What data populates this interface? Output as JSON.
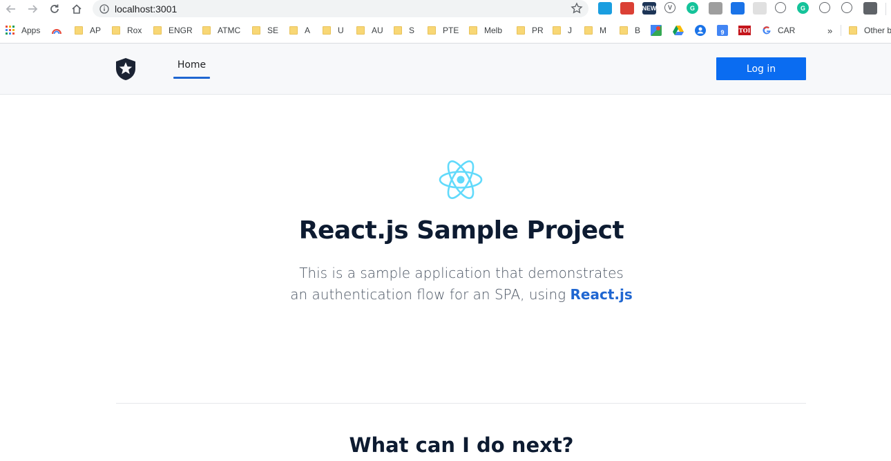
{
  "browser": {
    "url": "localhost:3001",
    "bookmarks": {
      "apps_label": "Apps",
      "items": [
        "AP",
        "Rox",
        "ENGR",
        "ATMC",
        "SE",
        "A",
        "U",
        "AU",
        "S",
        "PTE",
        "Melb",
        "PR",
        "J",
        "M",
        "B"
      ],
      "car_label": "CAR",
      "other_label": "Other b",
      "overflow_label": "»"
    },
    "extensions": [
      {
        "name": "tab-ext-icon",
        "color": "#1a9ee0",
        "text": ""
      },
      {
        "name": "todoist-icon",
        "color": "#db4035",
        "text": ""
      },
      {
        "name": "news-icon",
        "color": "#1d3557",
        "text": "NEW"
      },
      {
        "name": "vector-icon",
        "color": "#ffffff",
        "text": "V"
      },
      {
        "name": "grammarly-icon",
        "color": "#15c39a",
        "text": "G"
      },
      {
        "name": "avatar-ext-icon",
        "color": "#9e9e9e",
        "text": ""
      },
      {
        "name": "shield-ext-icon",
        "color": "#1a73e8",
        "text": ""
      },
      {
        "name": "speed-ext-icon",
        "color": "#e0e0e0",
        "text": ""
      },
      {
        "name": "history-ext-icon",
        "color": "#ffffff",
        "text": ""
      },
      {
        "name": "grammarly-alt-icon",
        "color": "#15c39a",
        "text": "G"
      },
      {
        "name": "code-ext-icon",
        "color": "#ffffff",
        "text": ""
      },
      {
        "name": "refresh-ext-icon",
        "color": "#ffffff",
        "text": ""
      },
      {
        "name": "pin-ext-icon",
        "color": "#5f6368",
        "text": ""
      }
    ],
    "bookmark_other_icons": {
      "toi_text": "TOI",
      "calendar_text": "9"
    }
  },
  "nav": {
    "home_label": "Home",
    "login_label": "Log in"
  },
  "hero": {
    "title": "React.js Sample Project",
    "text": "This is a sample application that demonstrates an authentication flow for an SPA, using ",
    "link": "React.js"
  },
  "next": {
    "title": "What can I do next?"
  },
  "colors": {
    "accent": "#0a6cf1",
    "link": "#1f66d1",
    "react": "#61dafb",
    "heading": "#0d1b31"
  }
}
